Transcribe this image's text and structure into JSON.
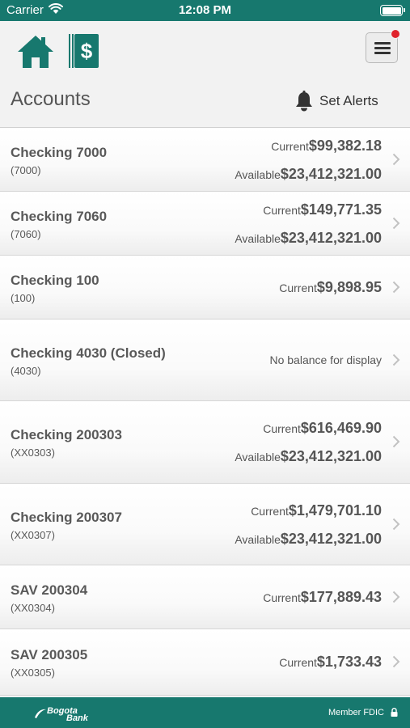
{
  "status_bar": {
    "carrier": "Carrier",
    "time": "12:08 PM"
  },
  "nav": {
    "home_icon": "home-icon",
    "money_icon": "money-icon",
    "menu_icon": "hamburger-menu-icon",
    "notification_badge_color": "#e0232c"
  },
  "header": {
    "title": "Accounts",
    "alerts_label": "Set Alerts"
  },
  "accounts": [
    {
      "name": "Checking 7000",
      "number": "(7000)",
      "current_label": "Current",
      "current": "$99,382.18",
      "available_label": "Available",
      "available": "$23,412,321.00"
    },
    {
      "name": "Checking 7060",
      "number": "(7060)",
      "current_label": "Current",
      "current": "$149,771.35",
      "available_label": "Available",
      "available": "$23,412,321.00"
    },
    {
      "name": "Checking 100",
      "number": "(100)",
      "current_label": "Current",
      "current": "$9,898.95"
    },
    {
      "name": "Checking 4030 (Closed)",
      "number": "(4030)",
      "no_balance": "No balance for display"
    },
    {
      "name": "Checking 200303",
      "number": "(XX0303)",
      "current_label": "Current",
      "current": "$616,469.90",
      "available_label": "Available",
      "available": "$23,412,321.00"
    },
    {
      "name": "Checking 200307",
      "number": "(XX0307)",
      "current_label": "Current",
      "current": "$1,479,701.10",
      "available_label": "Available",
      "available": "$23,412,321.00"
    },
    {
      "name": "SAV 200304",
      "number": "(XX0304)",
      "current_label": "Current",
      "current": "$177,889.43"
    },
    {
      "name": "SAV 200305",
      "number": "(XX0305)",
      "current_label": "Current",
      "current": "$1,733.43"
    }
  ],
  "footer": {
    "logo_line1": "Bogota",
    "logo_line2": "Bank",
    "member": "Member FDIC"
  },
  "colors": {
    "brand": "#17786e",
    "text": "#555555"
  }
}
